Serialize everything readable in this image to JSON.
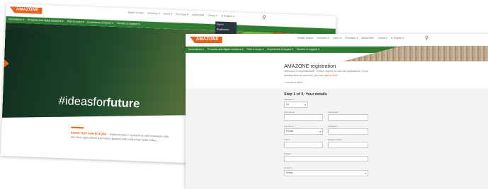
{
  "back_window": {
    "logo": "AMAZONE",
    "top_links": [
      "Dealer locator",
      "Germany ▾",
      "Users ▾",
      "Purchase ▾",
      "AMAZONE",
      "Career ▾",
      "⊕ English ▾"
    ],
    "nav_items": [
      "Innovations ▾",
      "Products and digital solutions ▾",
      "Plan & crops ▾",
      "Experience & impact ▾",
      "Service & support ▾"
    ],
    "dropdown_items": [
      "Sign in",
      "Registration"
    ],
    "hero_hashtag_prefix": "#ideas",
    "hero_hashtag_mid": "for",
    "hero_hashtag_suffix": "future",
    "text_line1_bold": "IDEAS FOR OUR FUTURE",
    "text_line1_rest": " – implemented in a practical and innovative way",
    "text_line2": "and thus agricultural machinery packed with ideas that helps today…"
  },
  "front_window": {
    "logo": "AMAZONE",
    "top_links": [
      "Dealer locator",
      "Germany ▾",
      "Users ▾",
      "Purchase ▾",
      "AMAZONE",
      "Career ▾",
      "⊕ English ▾"
    ],
    "nav_items": [
      "Innovations ▾",
      "Products and digital solutions ▾",
      "Plan & crops ▾",
      "Experience & impact ▾",
      "Service & support ▾"
    ],
    "title": "AMAZONE registration",
    "intro_line1": "Welcome to myAMAZONE. Please register to use our applications. If you",
    "intro_line2": "already have an account, you can",
    "intro_link": "sign in here.",
    "mandatory_note": "* mandatory fields",
    "step_title": "Step 1 of 3: Your details",
    "fields": {
      "salutation": {
        "label": "Salutation*",
        "value": "Mr."
      },
      "first_name": {
        "label": "First name*",
        "value": ""
      },
      "last_name": {
        "label": "Last name*",
        "value": ""
      },
      "you_are": {
        "label": "You are a...*",
        "value": "Private"
      },
      "company": {
        "label": "Company",
        "value": ""
      },
      "phone": {
        "label": "Phone",
        "value": ""
      },
      "mobile": {
        "label": "Mobile number",
        "value": ""
      },
      "email": {
        "label": "E-Mail*",
        "value": ""
      },
      "country": {
        "label": "Country*",
        "value": "Select"
      }
    }
  },
  "colors": {
    "brand_orange": "#e8601c",
    "nav_green": "#2e7d33"
  }
}
